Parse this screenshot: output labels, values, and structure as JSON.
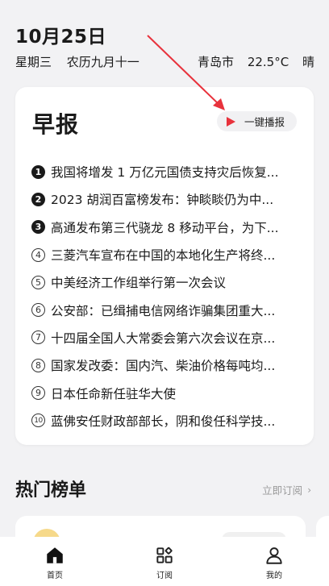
{
  "header": {
    "date": "10月25日",
    "weekday": "星期三",
    "lunar": "农历九月十一",
    "city": "青岛市",
    "temperature": "22.5°C",
    "weather": "晴"
  },
  "briefing": {
    "title": "早报",
    "play_label": "一键播报",
    "accent_color": "#e8323c",
    "items": [
      {
        "num": "1",
        "text": "我国将增发 1 万亿元国债支持灾后恢复..."
      },
      {
        "num": "2",
        "text": "2023 胡润百富榜发布：钟睒睒仍为中..."
      },
      {
        "num": "3",
        "text": "高通发布第三代骁龙 8 移动平台，为下..."
      },
      {
        "num": "4",
        "text": "三菱汽车宣布在中国的本地化生产将终..."
      },
      {
        "num": "5",
        "text": "中美经济工作组举行第一次会议"
      },
      {
        "num": "6",
        "text": "公安部：已缉捕电信网络诈骗集团重大..."
      },
      {
        "num": "7",
        "text": "十四届全国人大常委会第六次会议在京..."
      },
      {
        "num": "8",
        "text": "国家发改委：国内汽、柴油价格每吨均..."
      },
      {
        "num": "9",
        "text": "日本任命新任驻华大使"
      },
      {
        "num": "10",
        "text": "蓝佛安任财政部部长，阴和俊任科学技..."
      }
    ]
  },
  "hot_list": {
    "title": "热门榜单",
    "subscribe_label": "立即订阅"
  },
  "tabs": [
    {
      "label": "首页",
      "icon": "home-icon"
    },
    {
      "label": "订阅",
      "icon": "grid-icon"
    },
    {
      "label": "我的",
      "icon": "person-icon"
    }
  ]
}
